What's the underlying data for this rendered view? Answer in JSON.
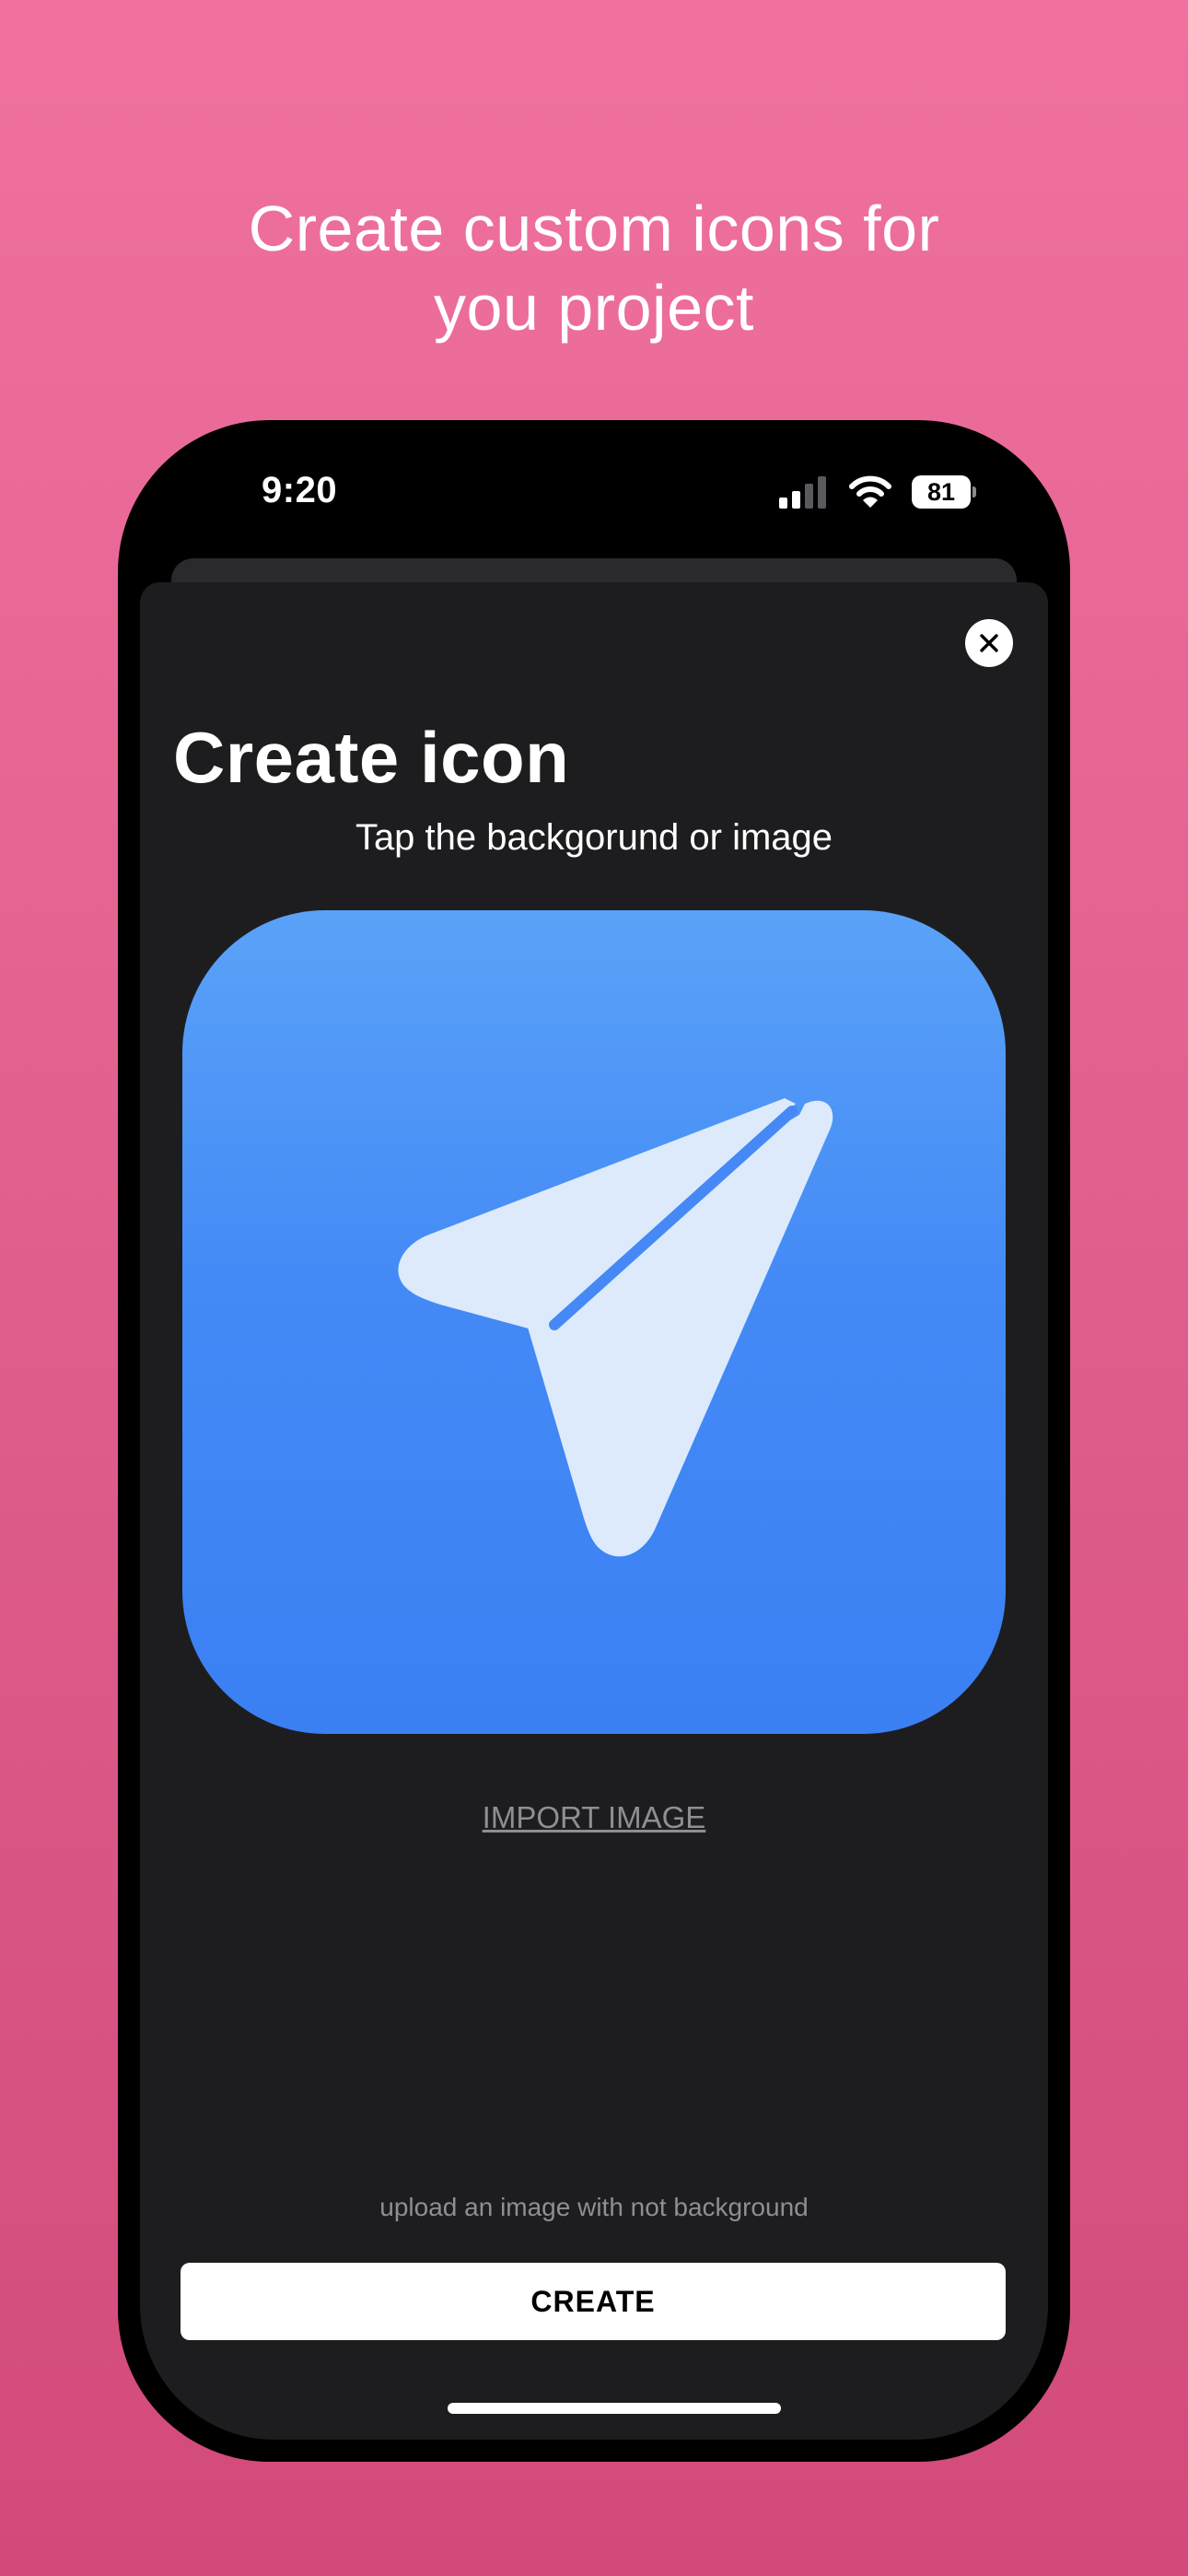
{
  "headline": {
    "line1": "Create custom icons for",
    "line2": "you project"
  },
  "status_bar": {
    "time": "9:20",
    "battery_level": "81",
    "icons": [
      "signal-icon",
      "wifi-icon",
      "battery-icon"
    ]
  },
  "sheet": {
    "title": "Create icon",
    "subtitle": "Tap the backgorund or image",
    "close_icon": "close-icon",
    "preview_icon": "paper-plane-icon",
    "import_label": "IMPORT IMAGE",
    "hint": "upload an image with not background",
    "create_label": "CREATE"
  },
  "colors": {
    "page_background_top": "#f0719f",
    "page_background_bottom": "#d24a7b",
    "sheet_background": "#1d1d1f",
    "icon_gradient_top": "#5aa2f8",
    "icon_gradient_bottom": "#3a80f3",
    "plane_fill": "#dceafb"
  }
}
